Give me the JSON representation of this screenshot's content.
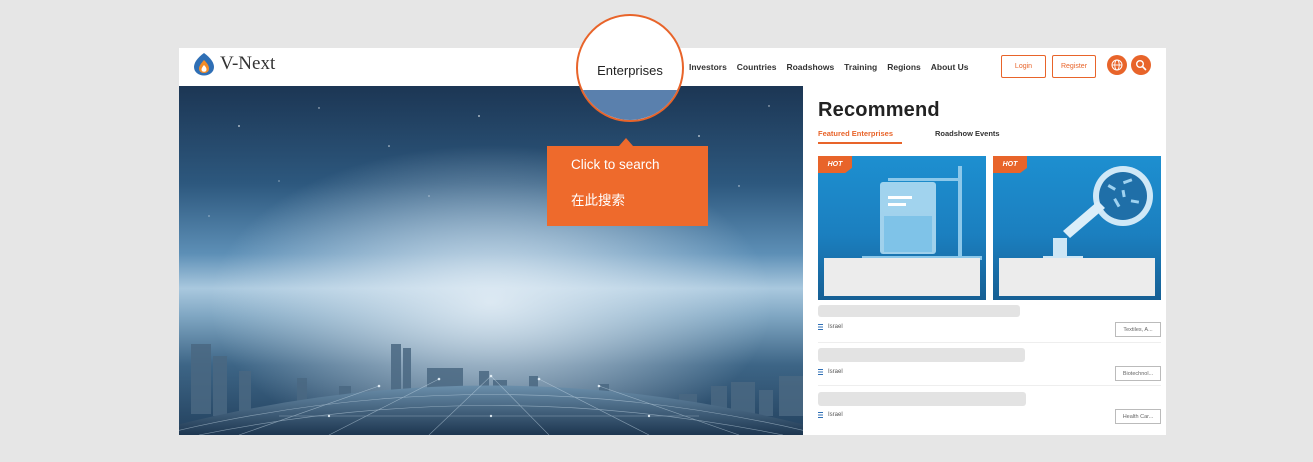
{
  "brand": {
    "name": "V-Next"
  },
  "nav": {
    "items": [
      "Investors",
      "Countries",
      "Roadshows",
      "Training",
      "Regions",
      "About Us"
    ],
    "login": "Login",
    "register": "Register"
  },
  "spotlight": {
    "label": "Enterprises"
  },
  "tooltip": {
    "line1": "Click to search",
    "line2": "在此搜索"
  },
  "recommend": {
    "title": "Recommend",
    "tabs": [
      "Featured Enterprises",
      "Roadshow Events"
    ],
    "cards": [
      {
        "badge": "HOT"
      },
      {
        "badge": "HOT"
      }
    ],
    "items": [
      {
        "location": "Israel",
        "tag": "Textiles, A..."
      },
      {
        "location": "Israel",
        "tag": "Biotechnol..."
      },
      {
        "location": "Israel",
        "tag": "Health Car..."
      }
    ]
  },
  "colors": {
    "accent": "#e8642a",
    "card_blue": "#1b7fbf"
  },
  "icons": [
    "logo-flame-icon",
    "globe-icon",
    "search-icon",
    "location-pin-icon"
  ]
}
